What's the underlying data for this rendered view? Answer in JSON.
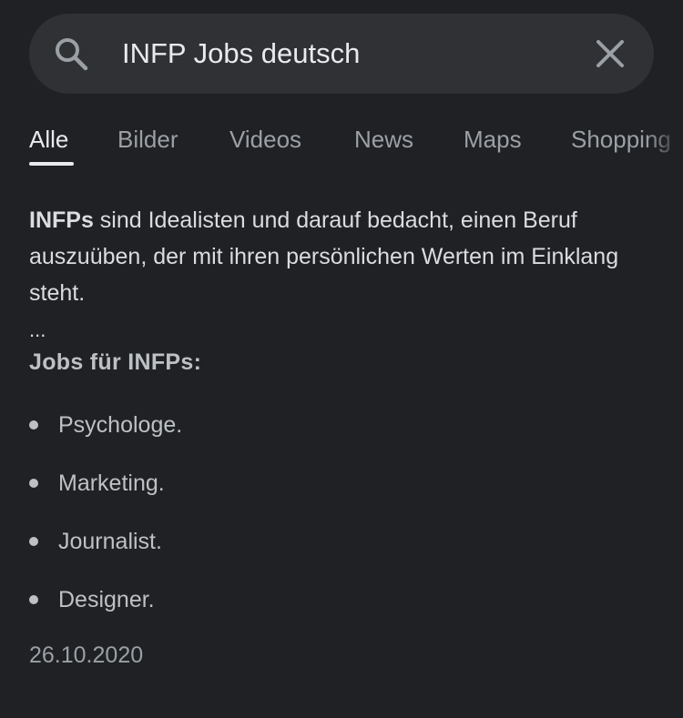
{
  "search": {
    "query": "INFP Jobs deutsch"
  },
  "tabs": [
    {
      "label": "Alle",
      "active": true
    },
    {
      "label": "Bilder",
      "active": false
    },
    {
      "label": "Videos",
      "active": false
    },
    {
      "label": "News",
      "active": false
    },
    {
      "label": "Maps",
      "active": false
    },
    {
      "label": "Shopping",
      "active": false
    }
  ],
  "snippet": {
    "bold_term": "INFPs",
    "text": " sind Idealisten und darauf bedacht, einen Beruf auszuüben, der mit ihren persönlichen Werten im Einklang steht.",
    "ellipsis": "...",
    "list_heading": "Jobs für INFPs:",
    "list_items": [
      "Psychologe.",
      "Marketing.",
      "Journalist.",
      "Designer."
    ],
    "date": "26.10.2020"
  },
  "icons": {
    "search": "search-icon",
    "clear": "close-icon"
  },
  "colors": {
    "background": "#202124",
    "search_bar": "#303134",
    "text_primary": "#e8eaed",
    "text_secondary": "#9aa0a6"
  }
}
